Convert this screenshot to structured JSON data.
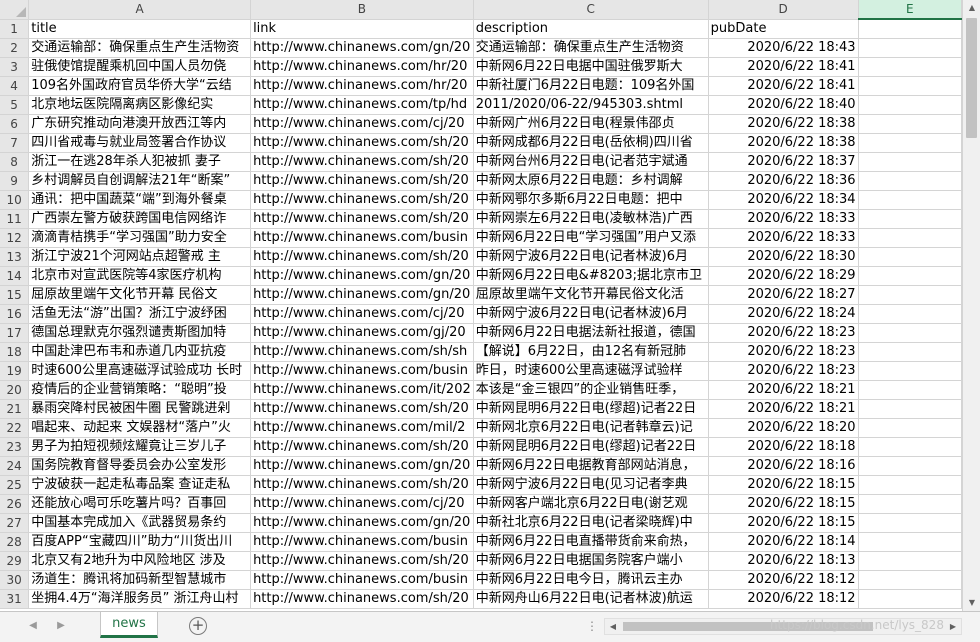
{
  "columns": [
    "A",
    "B",
    "C",
    "D",
    "E"
  ],
  "selected_column": "E",
  "header_row": {
    "row": "1",
    "title": "title",
    "link": "link",
    "description": "description",
    "pubDate": "pubDate"
  },
  "rows": [
    {
      "row": "2",
      "title": "交通运输部：确保重点生产生活物资",
      "link": "http://www.chinanews.com/gn/20",
      "description": "交通运输部：确保重点生产生活物资",
      "pubDate": "2020/6/22 18:43"
    },
    {
      "row": "3",
      "title": "驻俄使馆提醒乘机回中国人员勿侥",
      "link": "http://www.chinanews.com/hr/20",
      "description": "中新网6月22日电据中国驻俄罗斯大",
      "pubDate": "2020/6/22 18:41"
    },
    {
      "row": "4",
      "title": "109名外国政府官员华侨大学“云结",
      "link": "http://www.chinanews.com/hr/20",
      "description": "中新社厦门6月22日电题：109名外国",
      "pubDate": "2020/6/22 18:41"
    },
    {
      "row": "5",
      "title": "北京地坛医院隔离病区影像纪实",
      "link": "http://www.chinanews.com/tp/hd",
      "description": "2011/2020/06-22/945303.shtml",
      "pubDate": "2020/6/22 18:40"
    },
    {
      "row": "6",
      "title": "广东研究推动向港澳开放西江等内",
      "link": "http://www.chinanews.com/cj/20",
      "description": "中新网广州6月22日电(程景伟邵贞",
      "pubDate": "2020/6/22 18:38"
    },
    {
      "row": "7",
      "title": "四川省戒毒与就业局签署合作协议",
      "link": "http://www.chinanews.com/sh/20",
      "description": "中新网成都6月22日电(岳依桐)四川省",
      "pubDate": "2020/6/22 18:38"
    },
    {
      "row": "8",
      "title": "浙江一在逃28年杀人犯被抓 妻子",
      "link": "http://www.chinanews.com/sh/20",
      "description": "中新网台州6月22日电(记者范宇斌通",
      "pubDate": "2020/6/22 18:37"
    },
    {
      "row": "9",
      "title": "乡村调解员自创调解法21年“断案”",
      "link": "http://www.chinanews.com/sh/20",
      "description": "中新网太原6月22日电题：乡村调解",
      "pubDate": "2020/6/22 18:36"
    },
    {
      "row": "10",
      "title": "通讯：把中国蔬菜“端”到海外餐桌",
      "link": "http://www.chinanews.com/sh/20",
      "description": "中新网鄂尔多斯6月22日电题：把中",
      "pubDate": "2020/6/22 18:34"
    },
    {
      "row": "11",
      "title": "广西崇左警方破获跨国电信网络诈",
      "link": "http://www.chinanews.com/sh/20",
      "description": "中新网崇左6月22日电(凌敏林浩)广西",
      "pubDate": "2020/6/22 18:33"
    },
    {
      "row": "12",
      "title": "滴滴青桔携手“学习强国”助力安全",
      "link": "http://www.chinanews.com/busin",
      "description": "中新网6月22日电“学习强国”用户又添",
      "pubDate": "2020/6/22 18:33"
    },
    {
      "row": "13",
      "title": "浙江宁波21个河网站点超警戒 主",
      "link": "http://www.chinanews.com/sh/20",
      "description": "中新网宁波6月22日电(记者林波)6月",
      "pubDate": "2020/6/22 18:30"
    },
    {
      "row": "14",
      "title": "北京市对宣武医院等4家医疗机构",
      "link": "http://www.chinanews.com/gn/20",
      "description": "中新网6月22日电&#8203;据北京市卫",
      "pubDate": "2020/6/22 18:29"
    },
    {
      "row": "15",
      "title": "屈原故里端午文化节开幕  民俗文",
      "link": "http://www.chinanews.com/gn/20",
      "description": "屈原故里端午文化节开幕民俗文化活",
      "pubDate": "2020/6/22 18:27"
    },
    {
      "row": "16",
      "title": "活鱼无法“游”出国？浙江宁波纾困",
      "link": "http://www.chinanews.com/cj/20",
      "description": "中新网宁波6月22日电(记者林波)6月",
      "pubDate": "2020/6/22 18:24"
    },
    {
      "row": "17",
      "title": "德国总理默克尔强烈谴责斯图加特",
      "link": "http://www.chinanews.com/gj/20",
      "description": "中新网6月22日电据法新社报道，德国",
      "pubDate": "2020/6/22 18:23"
    },
    {
      "row": "18",
      "title": "中国赴津巴布韦和赤道几内亚抗疫",
      "link": "http://www.chinanews.com/sh/sh",
      "description": "【解说】6月22日，由12名有新冠肺",
      "pubDate": "2020/6/22 18:23"
    },
    {
      "row": "19",
      "title": "时速600公里高速磁浮试验成功 长时",
      "link": "http://www.chinanews.com/busin",
      "description": "昨日，时速600公里高速磁浮试验样",
      "pubDate": "2020/6/22 18:23"
    },
    {
      "row": "20",
      "title": "疫情后的企业营销策略：“聪明”投",
      "link": "http://www.chinanews.com/it/202",
      "description": "本该是“金三银四”的企业销售旺季，",
      "pubDate": "2020/6/22 18:21"
    },
    {
      "row": "21",
      "title": "暴雨突降村民被困牛圈 民警跳进剁",
      "link": "http://www.chinanews.com/sh/20",
      "description": "中新网昆明6月22日电(缪超)记者22日",
      "pubDate": "2020/6/22 18:21"
    },
    {
      "row": "22",
      "title": "唱起来、动起来 文娱器材“落户”火",
      "link": "http://www.chinanews.com/mil/2",
      "description": "中新网北京6月22日电(记者韩章云)记",
      "pubDate": "2020/6/22 18:20"
    },
    {
      "row": "23",
      "title": "男子为拍短视频炫耀竟让三岁儿子",
      "link": "http://www.chinanews.com/sh/20",
      "description": "中新网昆明6月22日电(缪超)记者22日",
      "pubDate": "2020/6/22 18:18"
    },
    {
      "row": "24",
      "title": "国务院教育督导委员会办公室发形",
      "link": "http://www.chinanews.com/gn/20",
      "description": "中新网6月22日电据教育部网站消息，",
      "pubDate": "2020/6/22 18:16"
    },
    {
      "row": "25",
      "title": "宁波破获一起走私毒品案 查证走私",
      "link": "http://www.chinanews.com/sh/20",
      "description": "中新网宁波6月22日电(见习记者李典",
      "pubDate": "2020/6/22 18:15"
    },
    {
      "row": "26",
      "title": "还能放心喝可乐吃薯片吗？百事回",
      "link": "http://www.chinanews.com/cj/20",
      "description": "中新网客户端北京6月22日电(谢艺观",
      "pubDate": "2020/6/22 18:15"
    },
    {
      "row": "27",
      "title": "中国基本完成加入《武器贸易条约",
      "link": "http://www.chinanews.com/gn/20",
      "description": "中新社北京6月22日电(记者梁晓辉)中",
      "pubDate": "2020/6/22 18:15"
    },
    {
      "row": "28",
      "title": "百度APP“宝藏四川”助力“川货出川",
      "link": "http://www.chinanews.com/busin",
      "description": "中新网6月22日电直播带货俞来俞热，",
      "pubDate": "2020/6/22 18:14"
    },
    {
      "row": "29",
      "title": "北京又有2地升为中风险地区 涉及",
      "link": "http://www.chinanews.com/sh/20",
      "description": "中新网6月22日电据国务院客户端小",
      "pubDate": "2020/6/22 18:13"
    },
    {
      "row": "30",
      "title": "汤道生：腾讯将加码新型智慧城市",
      "link": "http://www.chinanews.com/busin",
      "description": "中新网6月22日电今日，腾讯云主办",
      "pubDate": "2020/6/22 18:12"
    },
    {
      "row": "31",
      "title": "坐拥4.4万“海洋服务员” 浙江舟山村",
      "link": "http://www.chinanews.com/sh/20",
      "description": "中新网舟山6月22日电(记者林波)航运",
      "pubDate": "2020/6/22 18:12"
    }
  ],
  "sheet_tab": "news",
  "add_sheet_icon": "plus-circle-icon",
  "watermark": "https://blog.csdn.net/lys_828",
  "colors": {
    "accent": "#217346",
    "header_bg": "#e6e6e6",
    "gridline": "#d4d4d4"
  }
}
